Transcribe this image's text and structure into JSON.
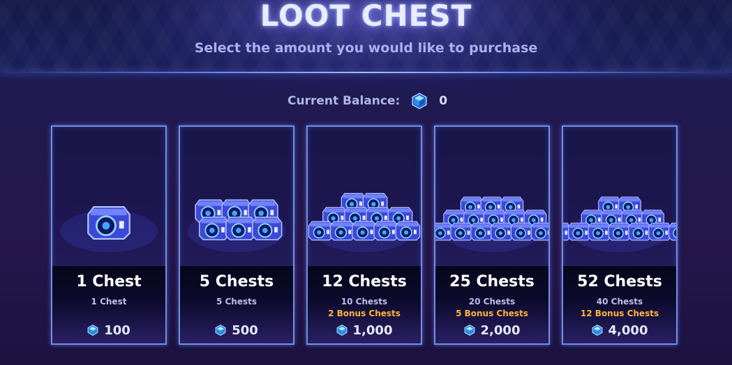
{
  "header": {
    "title": "LOOT CHEST",
    "subtitle": "Select the amount you would like to purchase"
  },
  "balance": {
    "label": "Current Balance:",
    "icon": "gem-icon",
    "value": "0"
  },
  "colors": {
    "accent_border": "#6f8fe6",
    "bonus_text": "#ffb23a",
    "gem": "#5fb8ff",
    "chest": "#3a49d8"
  },
  "offers": [
    {
      "title": "1 Chest",
      "sub": "1 Chest",
      "bonus": "",
      "price": "100",
      "chest_count": 1
    },
    {
      "title": "5 Chests",
      "sub": "5 Chests",
      "bonus": "",
      "price": "500",
      "chest_count": 5
    },
    {
      "title": "12 Chests",
      "sub": "10 Chests",
      "bonus": "2 Bonus Chests",
      "price": "1,000",
      "chest_count": 12
    },
    {
      "title": "25 Chests",
      "sub": "20 Chests",
      "bonus": "5 Bonus Chests",
      "price": "2,000",
      "chest_count": 25
    },
    {
      "title": "52 Chests",
      "sub": "40 Chests",
      "bonus": "12 Bonus Chests",
      "price": "4,000",
      "chest_count": 52
    }
  ]
}
